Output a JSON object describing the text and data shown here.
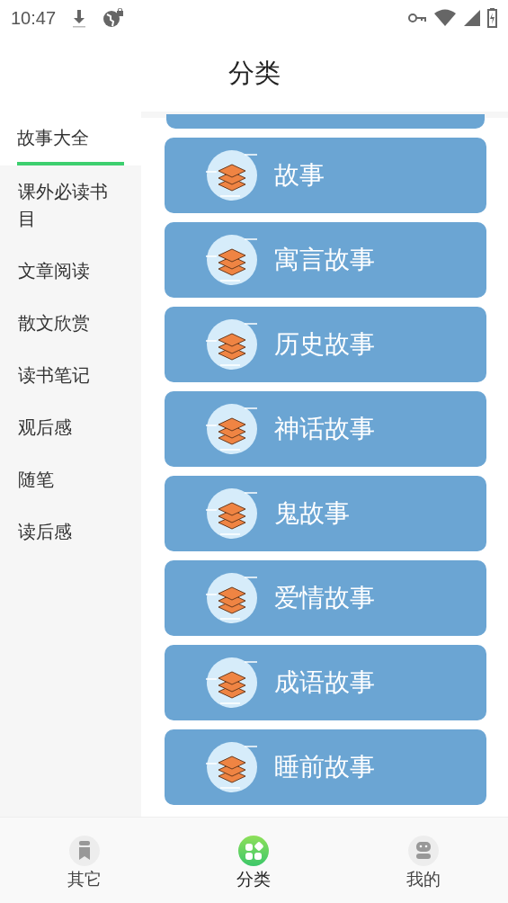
{
  "status_bar": {
    "time": "10:47"
  },
  "title": "分类",
  "sidebar": {
    "items": [
      {
        "label": "故事大全",
        "selected": true
      },
      {
        "label": "课外必读书目",
        "selected": false
      },
      {
        "label": "文章阅读",
        "selected": false
      },
      {
        "label": "散文欣赏",
        "selected": false
      },
      {
        "label": "读书笔记",
        "selected": false
      },
      {
        "label": "观后感",
        "selected": false
      },
      {
        "label": "随笔",
        "selected": false
      },
      {
        "label": "读后感",
        "selected": false
      }
    ]
  },
  "categories": [
    {
      "label": "故事"
    },
    {
      "label": "寓言故事"
    },
    {
      "label": "历史故事"
    },
    {
      "label": "神话故事"
    },
    {
      "label": "鬼故事"
    },
    {
      "label": "爱情故事"
    },
    {
      "label": "成语故事"
    },
    {
      "label": "睡前故事"
    }
  ],
  "bottom_nav": [
    {
      "label": "其它",
      "kind": "bookmark",
      "selected": false
    },
    {
      "label": "分类",
      "kind": "grid",
      "selected": true
    },
    {
      "label": "我的",
      "kind": "robot",
      "selected": false
    }
  ]
}
